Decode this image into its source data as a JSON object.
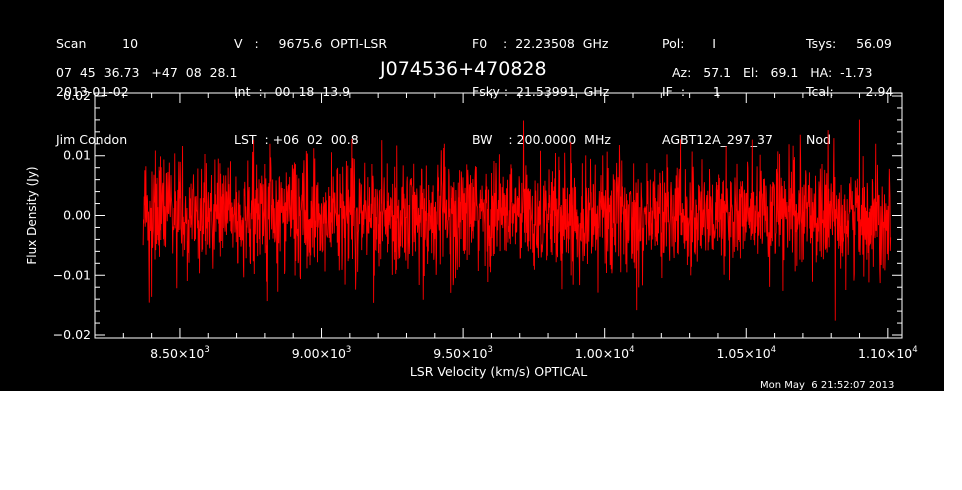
{
  "header": {
    "col1": [
      "Scan         10",
      "2013-01-02",
      "Jim Condon"
    ],
    "col2": [
      "V   :     9675.6  OPTI-LSR",
      "Int  :   00  18  13.9",
      "LST  : +06  02  00.8"
    ],
    "col3": [
      "F0    :  22.23508  GHz",
      "Fsky :  21.53991  GHz",
      "BW    : 200.0000  MHz"
    ],
    "col4": [
      "Pol:       I",
      "IF  :       1",
      "AGBT12A_297_37"
    ],
    "col5": [
      "Tsys:     56.09",
      "Tcal:        2.94",
      "Nod"
    ],
    "coords": "07  45  36.73   +47  08  28.1",
    "source": "J074536+470828",
    "azelha": "Az:   57.1   El:   69.1   HA:  -1.73",
    "timestamp": "Mon May  6 21:52:07 2013"
  },
  "colors": {
    "background": "#000000",
    "axes": "#ffffff",
    "series": "#ff0000",
    "page": "#ffffff"
  },
  "chart_data": {
    "type": "line",
    "title": "J074536+470828",
    "xlabel": "LSR Velocity (km/s) OPTICAL",
    "ylabel": "Flux Density (Jy)",
    "xlim": [
      8200,
      11050
    ],
    "ylim": [
      -0.0205,
      0.0205
    ],
    "x_ticks": [
      8500,
      9000,
      9500,
      10000,
      10500,
      11000
    ],
    "x_tick_labels": [
      [
        "8.50",
        "3"
      ],
      [
        "9.00",
        "3"
      ],
      [
        "9.50",
        "3"
      ],
      [
        "1.00",
        "4"
      ],
      [
        "1.05",
        "4"
      ],
      [
        "1.10",
        "4"
      ]
    ],
    "x_tick_mult": "×10",
    "y_ticks": [
      0.02,
      0.01,
      0.0,
      -0.01,
      -0.02
    ],
    "y_tick_labels": [
      "0.02",
      "0.01",
      "0.00",
      "−0.01",
      "−0.02"
    ],
    "series": [
      {
        "x_range": [
          8370,
          11010
        ],
        "n_channels": 2200,
        "mean": 0.0,
        "rms": 0.0048,
        "min": -0.019,
        "max": 0.019,
        "noise_seed": 42
      }
    ],
    "grid": false
  }
}
